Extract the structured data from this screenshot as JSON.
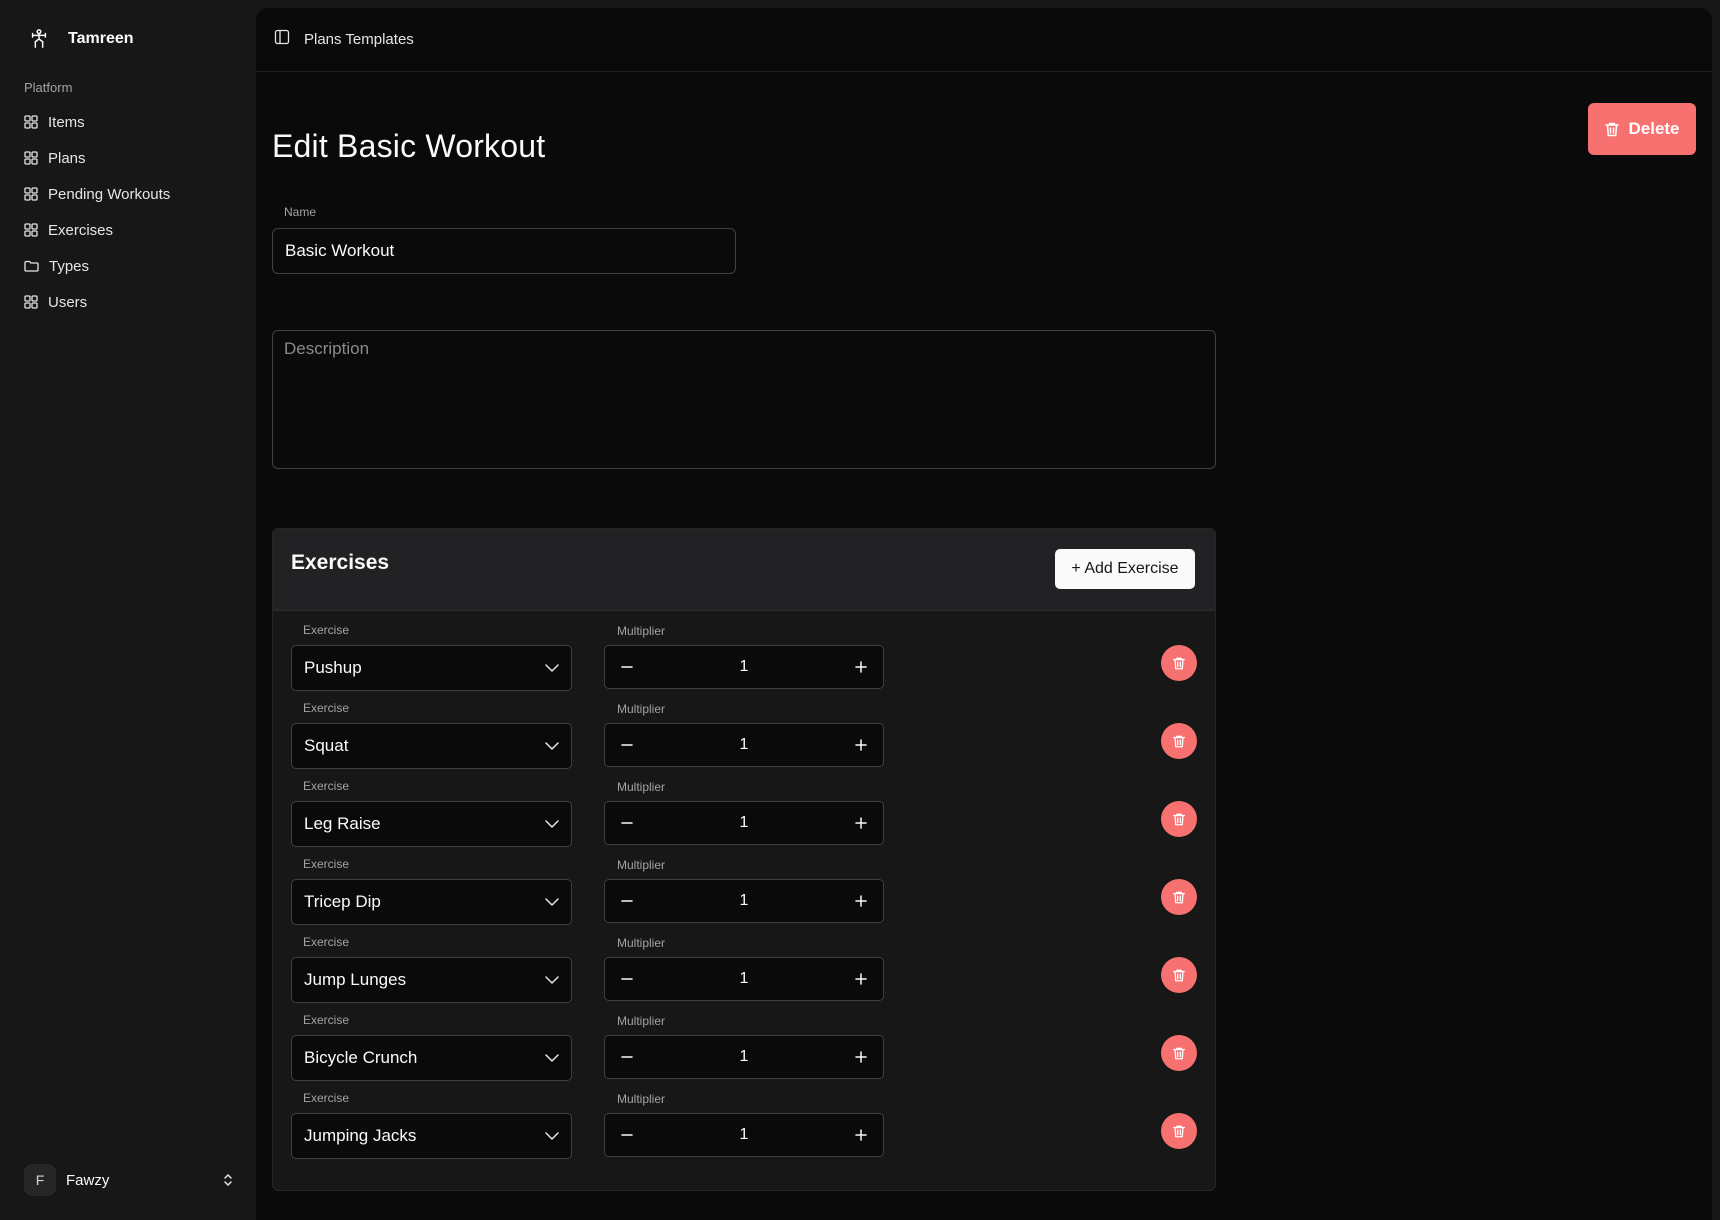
{
  "app": {
    "name": "Tamreen"
  },
  "sidebar": {
    "group_label": "Platform",
    "items": [
      {
        "label": "Items",
        "icon": "grid-icon"
      },
      {
        "label": "Plans",
        "icon": "grid-icon"
      },
      {
        "label": "Pending Workouts",
        "icon": "grid-icon"
      },
      {
        "label": "Exercises",
        "icon": "grid-icon"
      },
      {
        "label": "Types",
        "icon": "folder-icon"
      },
      {
        "label": "Users",
        "icon": "grid-icon"
      }
    ],
    "user": {
      "initial": "F",
      "name": "Fawzy"
    }
  },
  "header": {
    "title": "Plans Templates"
  },
  "page": {
    "title": "Edit Basic Workout",
    "delete_label": "Delete",
    "name_label": "Name",
    "name_value": "Basic Workout",
    "description_placeholder": "Description"
  },
  "exercises": {
    "title": "Exercises",
    "add_label": "+ Add Exercise",
    "exercise_label": "Exercise",
    "multiplier_label": "Multiplier",
    "rows": [
      {
        "exercise": "Pushup",
        "multiplier": "1"
      },
      {
        "exercise": "Squat",
        "multiplier": "1"
      },
      {
        "exercise": "Leg Raise",
        "multiplier": "1"
      },
      {
        "exercise": "Tricep Dip",
        "multiplier": "1"
      },
      {
        "exercise": "Jump Lunges",
        "multiplier": "1"
      },
      {
        "exercise": "Bicycle Crunch",
        "multiplier": "1"
      },
      {
        "exercise": "Jumping Jacks",
        "multiplier": "1"
      }
    ]
  },
  "colors": {
    "accent_danger": "#f87171",
    "background": "#0a0a0a",
    "sidebar": "#171717"
  }
}
